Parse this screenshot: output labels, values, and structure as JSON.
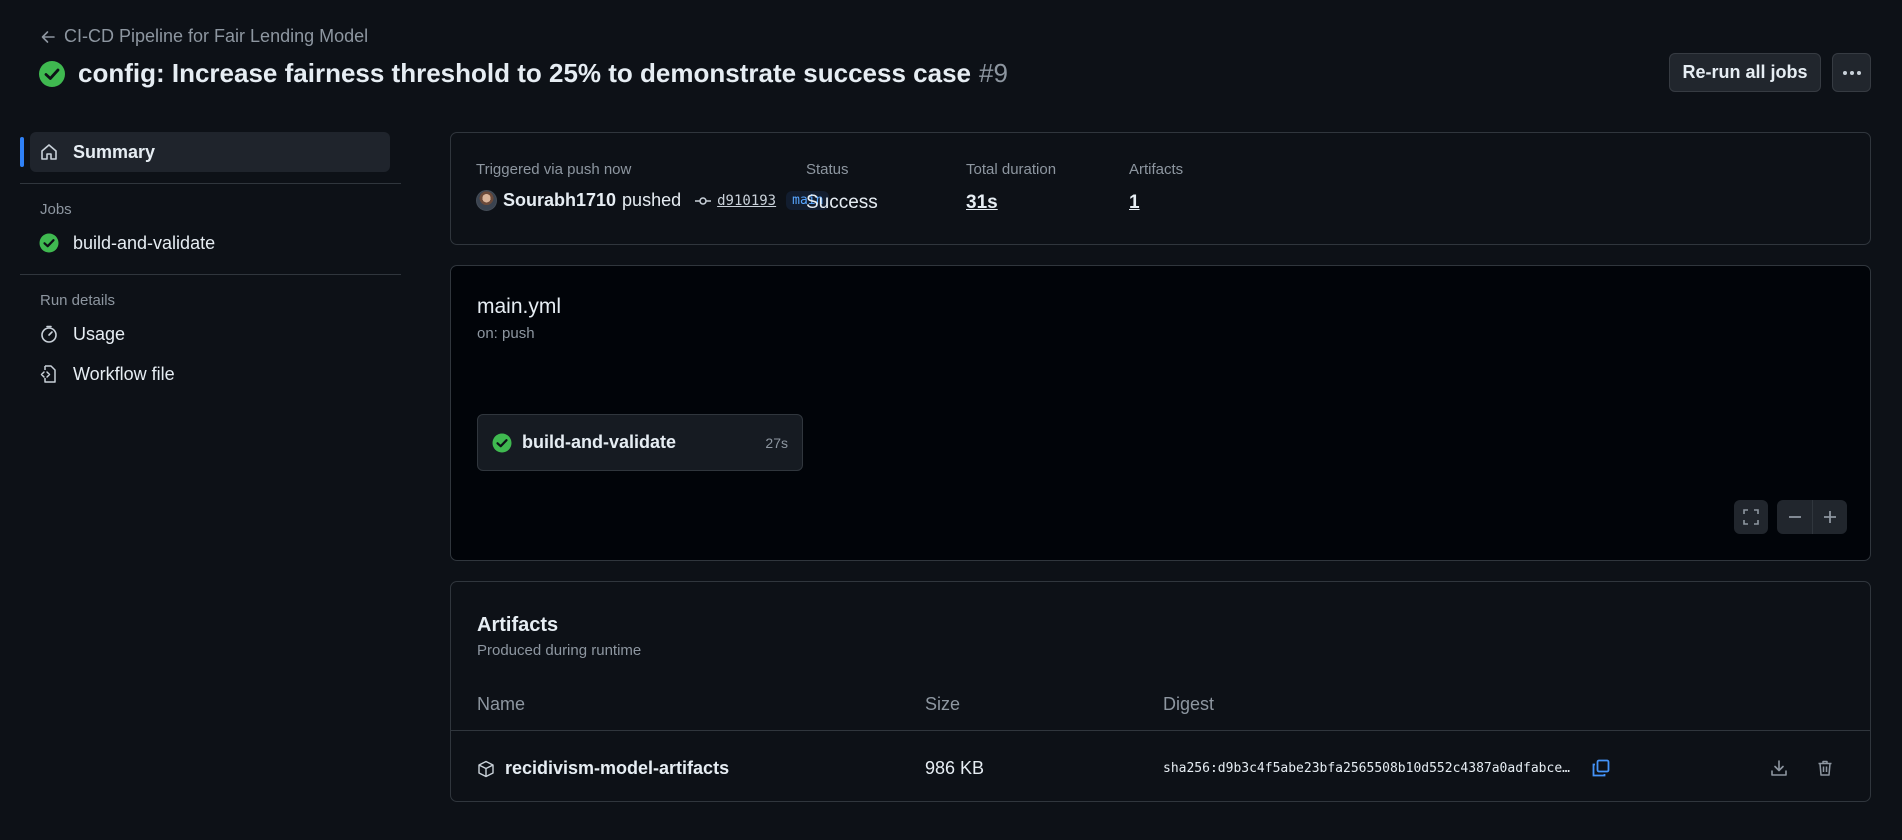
{
  "header": {
    "back_label": "CI-CD Pipeline for Fair Lending Model",
    "title": "config: Increase fairness threshold to 25% to demonstrate success case",
    "run_number": "#9",
    "rerun_label": "Re-run all jobs"
  },
  "sidebar": {
    "summary_label": "Summary",
    "jobs_heading": "Jobs",
    "jobs": [
      {
        "label": "build-and-validate",
        "status": "success"
      }
    ],
    "run_details_heading": "Run details",
    "usage_label": "Usage",
    "workflow_file_label": "Workflow file"
  },
  "summary": {
    "trigger_label": "Triggered via push now",
    "user": "Sourabh1710",
    "action": "pushed",
    "commit_sha": "d910193",
    "branch": "main",
    "status_label": "Status",
    "status_value": "Success",
    "duration_label": "Total duration",
    "duration_value": "31s",
    "artifacts_label": "Artifacts",
    "artifacts_value": "1"
  },
  "graph": {
    "workflow_file": "main.yml",
    "trigger": "on: push",
    "job_name": "build-and-validate",
    "job_duration": "27s"
  },
  "artifacts": {
    "title": "Artifacts",
    "subtitle": "Produced during runtime",
    "columns": [
      "Name",
      "Size",
      "Digest"
    ],
    "rows": [
      {
        "name": "recidivism-model-artifacts",
        "size": "986 KB",
        "digest": "sha256:d9b3c4f5abe23bfa2565508b10d552c4387a0adfabce…"
      }
    ]
  },
  "colors": {
    "success": "#3fb950",
    "accent": "#2f81f7",
    "background": "#0d1117"
  }
}
